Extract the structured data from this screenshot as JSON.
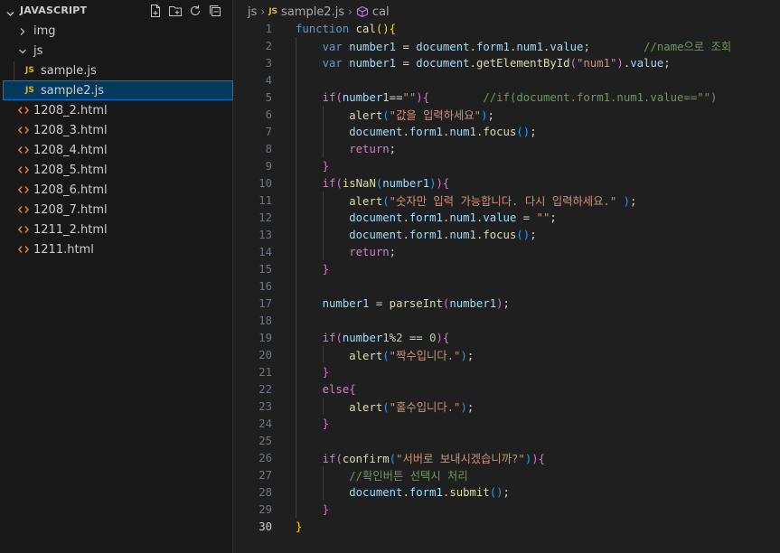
{
  "explorer": {
    "section_title": "JAVASCRIPT",
    "actions": [
      "new-file-icon",
      "new-folder-icon",
      "refresh-icon",
      "collapse-all-icon"
    ],
    "items": [
      {
        "type": "folder",
        "label": "img",
        "expanded": false,
        "indent": 0
      },
      {
        "type": "folder",
        "label": "js",
        "expanded": true,
        "indent": 0
      },
      {
        "type": "js",
        "label": "sample.js",
        "indent": 1,
        "selected": false
      },
      {
        "type": "js",
        "label": "sample2.js",
        "indent": 1,
        "selected": true
      },
      {
        "type": "html",
        "label": "1208_2.html",
        "indent": 0
      },
      {
        "type": "html",
        "label": "1208_3.html",
        "indent": 0
      },
      {
        "type": "html",
        "label": "1208_4.html",
        "indent": 0
      },
      {
        "type": "html",
        "label": "1208_5.html",
        "indent": 0
      },
      {
        "type": "html",
        "label": "1208_6.html",
        "indent": 0
      },
      {
        "type": "html",
        "label": "1208_7.html",
        "indent": 0
      },
      {
        "type": "html",
        "label": "1211_2.html",
        "indent": 0
      },
      {
        "type": "html",
        "label": "1211.html",
        "indent": 0
      }
    ],
    "js_badge": "JS"
  },
  "breadcrumb": {
    "folder": "js",
    "file": "sample2.js",
    "file_badge": "JS",
    "symbol": "cal"
  },
  "colors": {
    "keyword": "#569cd6",
    "control": "#c586c0",
    "function": "#dcdcaa",
    "variable": "#9cdcfe",
    "string": "#ce9178",
    "number": "#b5cea8",
    "comment": "#6a9955",
    "selection": "#04395e",
    "focus_border": "#0078d4"
  },
  "editor": {
    "active_line": 30,
    "lines": [
      {
        "n": "1",
        "t": [
          [
            "function",
            "kw"
          ],
          [
            " ",
            ""
          ],
          [
            "cal",
            "fn"
          ],
          [
            "(",
            "br1"
          ],
          [
            ")",
            "br1"
          ],
          [
            "{",
            "br1"
          ]
        ]
      },
      {
        "n": "2",
        "t": [
          [
            "    ",
            ""
          ],
          [
            "var",
            "kw"
          ],
          [
            " ",
            ""
          ],
          [
            "number1",
            "var"
          ],
          [
            " = ",
            "pun"
          ],
          [
            "document",
            "var"
          ],
          [
            ".",
            "pun"
          ],
          [
            "form1",
            "var"
          ],
          [
            ".",
            "pun"
          ],
          [
            "num1",
            "var"
          ],
          [
            ".",
            "pun"
          ],
          [
            "value",
            "var"
          ],
          [
            ";",
            "pun"
          ],
          [
            "        ",
            ""
          ],
          [
            "//name으로 조회",
            "cmt"
          ]
        ]
      },
      {
        "n": "3",
        "t": [
          [
            "    ",
            ""
          ],
          [
            "var",
            "kw"
          ],
          [
            " ",
            ""
          ],
          [
            "number1",
            "var"
          ],
          [
            " = ",
            "pun"
          ],
          [
            "document",
            "var"
          ],
          [
            ".",
            "pun"
          ],
          [
            "getElementById",
            "fn"
          ],
          [
            "(",
            "br2"
          ],
          [
            "\"num1\"",
            "str"
          ],
          [
            ")",
            "br2"
          ],
          [
            ".",
            "pun"
          ],
          [
            "value",
            "var"
          ],
          [
            ";",
            "pun"
          ]
        ]
      },
      {
        "n": "4",
        "t": []
      },
      {
        "n": "5",
        "t": [
          [
            "    ",
            ""
          ],
          [
            "if",
            "ctl"
          ],
          [
            "(",
            "br2"
          ],
          [
            "number1",
            "var"
          ],
          [
            "==",
            "pun"
          ],
          [
            "\"\"",
            "str"
          ],
          [
            ")",
            "br2"
          ],
          [
            "{",
            "br2"
          ],
          [
            "        ",
            ""
          ],
          [
            "//if(document.form1.num1.value==\"\")",
            "cmt"
          ]
        ]
      },
      {
        "n": "6",
        "t": [
          [
            "        ",
            ""
          ],
          [
            "alert",
            "fn"
          ],
          [
            "(",
            "br3"
          ],
          [
            "\"값을 입력하세요\"",
            "str"
          ],
          [
            ")",
            "br3"
          ],
          [
            ";",
            "pun"
          ]
        ]
      },
      {
        "n": "7",
        "t": [
          [
            "        ",
            ""
          ],
          [
            "document",
            "var"
          ],
          [
            ".",
            "pun"
          ],
          [
            "form1",
            "var"
          ],
          [
            ".",
            "pun"
          ],
          [
            "num1",
            "var"
          ],
          [
            ".",
            "pun"
          ],
          [
            "focus",
            "fn"
          ],
          [
            "(",
            "br3"
          ],
          [
            ")",
            "br3"
          ],
          [
            ";",
            "pun"
          ]
        ]
      },
      {
        "n": "8",
        "t": [
          [
            "        ",
            ""
          ],
          [
            "return",
            "ctl"
          ],
          [
            ";",
            "pun"
          ]
        ]
      },
      {
        "n": "9",
        "t": [
          [
            "    ",
            ""
          ],
          [
            "}",
            "br2"
          ]
        ]
      },
      {
        "n": "10",
        "t": [
          [
            "    ",
            ""
          ],
          [
            "if",
            "ctl"
          ],
          [
            "(",
            "br2"
          ],
          [
            "isNaN",
            "fn"
          ],
          [
            "(",
            "br3"
          ],
          [
            "number1",
            "var"
          ],
          [
            ")",
            "br3"
          ],
          [
            ")",
            "br2"
          ],
          [
            "{",
            "br2"
          ]
        ]
      },
      {
        "n": "11",
        "t": [
          [
            "        ",
            ""
          ],
          [
            "alert",
            "fn"
          ],
          [
            "(",
            "br3"
          ],
          [
            "\"숫자만 입력 가능합니다. 다시 입력하세요.\"",
            "str"
          ],
          [
            " ",
            ""
          ],
          [
            ")",
            "br3"
          ],
          [
            ";",
            "pun"
          ]
        ]
      },
      {
        "n": "12",
        "t": [
          [
            "        ",
            ""
          ],
          [
            "document",
            "var"
          ],
          [
            ".",
            "pun"
          ],
          [
            "form1",
            "var"
          ],
          [
            ".",
            "pun"
          ],
          [
            "num1",
            "var"
          ],
          [
            ".",
            "pun"
          ],
          [
            "value",
            "var"
          ],
          [
            " = ",
            "pun"
          ],
          [
            "\"\"",
            "str"
          ],
          [
            ";",
            "pun"
          ]
        ]
      },
      {
        "n": "13",
        "t": [
          [
            "        ",
            ""
          ],
          [
            "document",
            "var"
          ],
          [
            ".",
            "pun"
          ],
          [
            "form1",
            "var"
          ],
          [
            ".",
            "pun"
          ],
          [
            "num1",
            "var"
          ],
          [
            ".",
            "pun"
          ],
          [
            "focus",
            "fn"
          ],
          [
            "(",
            "br3"
          ],
          [
            ")",
            "br3"
          ],
          [
            ";",
            "pun"
          ]
        ]
      },
      {
        "n": "14",
        "t": [
          [
            "        ",
            ""
          ],
          [
            "return",
            "ctl"
          ],
          [
            ";",
            "pun"
          ]
        ]
      },
      {
        "n": "15",
        "t": [
          [
            "    ",
            ""
          ],
          [
            "}",
            "br2"
          ]
        ]
      },
      {
        "n": "16",
        "t": []
      },
      {
        "n": "17",
        "t": [
          [
            "    ",
            ""
          ],
          [
            "number1",
            "var"
          ],
          [
            " = ",
            "pun"
          ],
          [
            "parseInt",
            "fn"
          ],
          [
            "(",
            "br2"
          ],
          [
            "number1",
            "var"
          ],
          [
            ")",
            "br2"
          ],
          [
            ";",
            "pun"
          ]
        ]
      },
      {
        "n": "18",
        "t": []
      },
      {
        "n": "19",
        "t": [
          [
            "    ",
            ""
          ],
          [
            "if",
            "ctl"
          ],
          [
            "(",
            "br2"
          ],
          [
            "number1",
            "var"
          ],
          [
            "%",
            "pun"
          ],
          [
            "2",
            "num"
          ],
          [
            " == ",
            "pun"
          ],
          [
            "0",
            "num"
          ],
          [
            ")",
            "br2"
          ],
          [
            "{",
            "br2"
          ]
        ]
      },
      {
        "n": "20",
        "t": [
          [
            "        ",
            ""
          ],
          [
            "alert",
            "fn"
          ],
          [
            "(",
            "br3"
          ],
          [
            "\"짝수입니다.\"",
            "str"
          ],
          [
            ")",
            "br3"
          ],
          [
            ";",
            "pun"
          ]
        ]
      },
      {
        "n": "21",
        "t": [
          [
            "    ",
            ""
          ],
          [
            "}",
            "br2"
          ]
        ]
      },
      {
        "n": "22",
        "t": [
          [
            "    ",
            ""
          ],
          [
            "else",
            "ctl"
          ],
          [
            "{",
            "br2"
          ]
        ]
      },
      {
        "n": "23",
        "t": [
          [
            "        ",
            ""
          ],
          [
            "alert",
            "fn"
          ],
          [
            "(",
            "br3"
          ],
          [
            "\"홀수입니다.\"",
            "str"
          ],
          [
            ")",
            "br3"
          ],
          [
            ";",
            "pun"
          ]
        ]
      },
      {
        "n": "24",
        "t": [
          [
            "    ",
            ""
          ],
          [
            "}",
            "br2"
          ]
        ]
      },
      {
        "n": "25",
        "t": []
      },
      {
        "n": "26",
        "t": [
          [
            "    ",
            ""
          ],
          [
            "if",
            "ctl"
          ],
          [
            "(",
            "br2"
          ],
          [
            "confirm",
            "fn"
          ],
          [
            "(",
            "br3"
          ],
          [
            "\"서버로 보내시겠습니까?\"",
            "str"
          ],
          [
            ")",
            "br3"
          ],
          [
            ")",
            "br2"
          ],
          [
            "{",
            "br2"
          ]
        ]
      },
      {
        "n": "27",
        "t": [
          [
            "        ",
            ""
          ],
          [
            "//확인버튼 선택시 처리",
            "cmt"
          ]
        ]
      },
      {
        "n": "28",
        "t": [
          [
            "        ",
            ""
          ],
          [
            "document",
            "var"
          ],
          [
            ".",
            "pun"
          ],
          [
            "form1",
            "var"
          ],
          [
            ".",
            "pun"
          ],
          [
            "submit",
            "fn"
          ],
          [
            "(",
            "br3"
          ],
          [
            ")",
            "br3"
          ],
          [
            ";",
            "pun"
          ]
        ]
      },
      {
        "n": "29",
        "t": [
          [
            "    ",
            ""
          ],
          [
            "}",
            "br2"
          ]
        ]
      },
      {
        "n": "30",
        "t": [
          [
            "}",
            "br1"
          ]
        ]
      }
    ]
  }
}
